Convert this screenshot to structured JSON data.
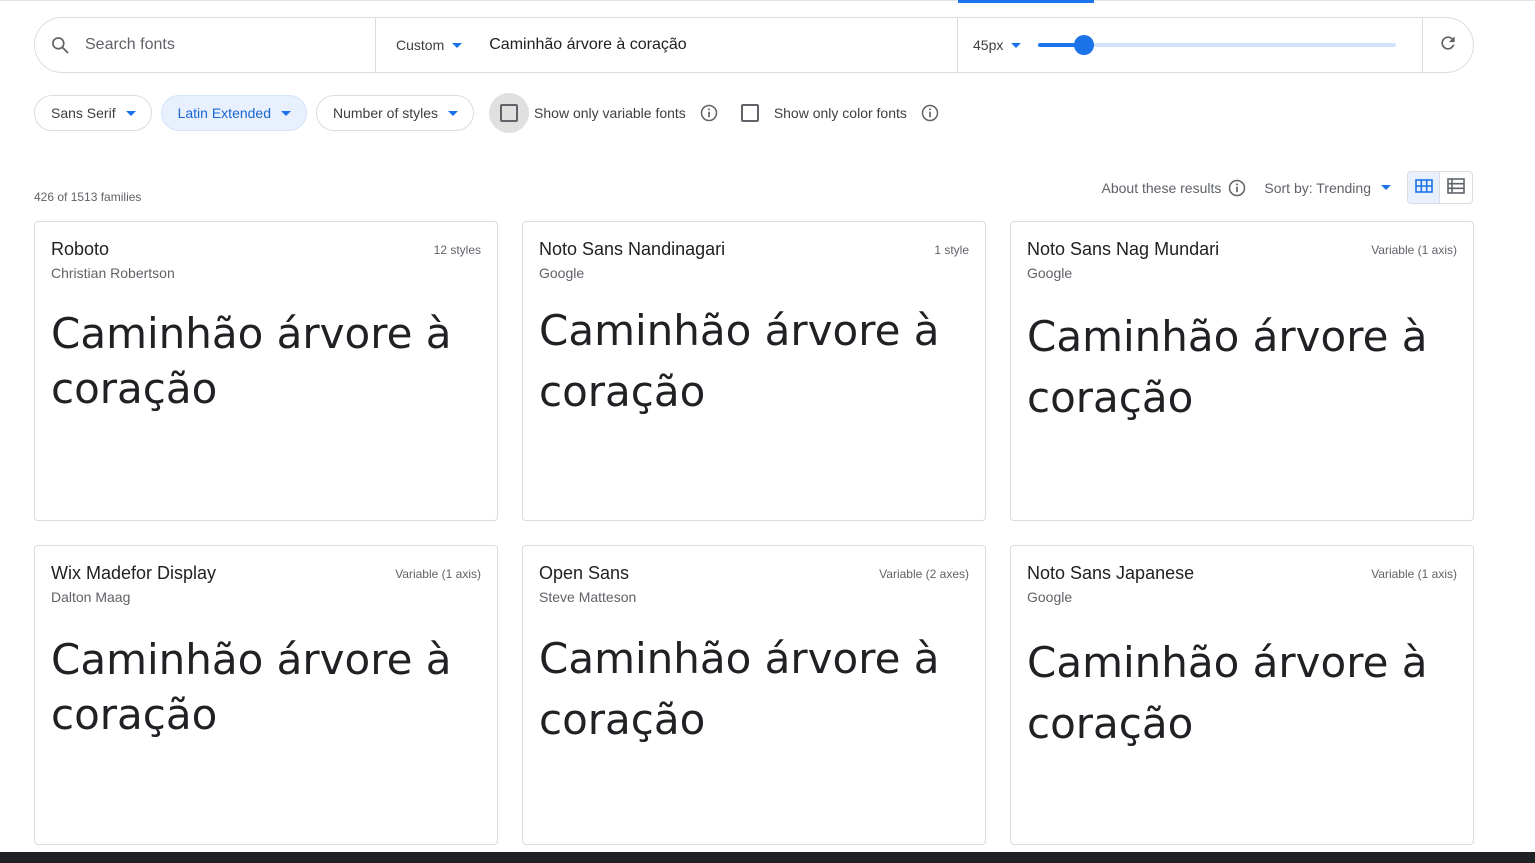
{
  "search": {
    "placeholder": "Search fonts",
    "value": ""
  },
  "preview": {
    "mode": "Custom",
    "text": "Caminhão árvore à coração"
  },
  "size": {
    "label": "45px",
    "value": 45,
    "min": 8,
    "max": 300
  },
  "filters": {
    "category": "Sans Serif",
    "language": "Latin Extended",
    "styles": "Number of styles",
    "variable_label": "Show only variable fonts",
    "color_label": "Show only color fonts"
  },
  "results": {
    "count": "426 of 1513 families",
    "about": "About these results",
    "sort": "Sort by: Trending"
  },
  "cards": [
    {
      "name": "Roboto",
      "designer": "Christian Robertson",
      "styles": "12 styles",
      "sample": "Caminhão árvore à coração"
    },
    {
      "name": "Noto Sans Nandinagari",
      "designer": "Google",
      "styles": "1 style",
      "sample": "Caminhão árvore à coração"
    },
    {
      "name": "Noto Sans Nag Mundari",
      "designer": "Google",
      "styles": "Variable (1 axis)",
      "sample": "Caminhão árvore à coração"
    },
    {
      "name": "Wix Madefor Display",
      "designer": "Dalton Maag",
      "styles": "Variable (1 axis)",
      "sample": "Caminhão árvore à coração"
    },
    {
      "name": "Open Sans",
      "designer": "Steve Matteson",
      "styles": "Variable (2 axes)",
      "sample": "Caminhão árvore à coração"
    },
    {
      "name": "Noto Sans Japanese",
      "designer": "Google",
      "styles": "Variable (1 axis)",
      "sample": "Caminhão árvore à coração"
    }
  ],
  "colors": {
    "accent": "#1a73e8",
    "chip_active_bg": "#e8f0fe",
    "border": "#dadce0"
  },
  "icons": [
    "search-icon",
    "refresh-icon",
    "info-icon",
    "grid-view-icon",
    "list-view-icon"
  ]
}
